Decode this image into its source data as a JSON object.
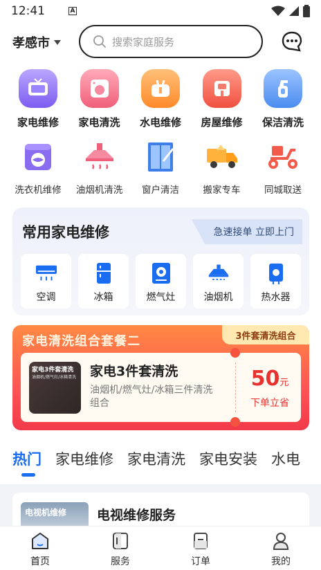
{
  "status_bar": {
    "time": "12:41",
    "a_icon": "A"
  },
  "header": {
    "city": "孝感市",
    "search_placeholder": "搜索家庭服务"
  },
  "main_services": [
    {
      "label": "家电维修",
      "icon": "tv-icon",
      "color": "#8a6cf0"
    },
    {
      "label": "家电清洗",
      "icon": "washer-icon",
      "color": "#f0607a"
    },
    {
      "label": "水电维修",
      "icon": "wrench-icon",
      "color": "#ff8a2a"
    },
    {
      "label": "房屋维修",
      "icon": "house-icon",
      "color": "#f25a4a"
    },
    {
      "label": "保洁清洗",
      "icon": "spray-icon",
      "color": "#4a8cf0"
    }
  ],
  "sub_services": [
    {
      "label": "洗衣机维修",
      "icon": "washing-machine-icon"
    },
    {
      "label": "油烟机清洗",
      "icon": "range-hood-icon"
    },
    {
      "label": "窗户清洁",
      "icon": "window-icon"
    },
    {
      "label": "搬家专车",
      "icon": "truck-icon"
    },
    {
      "label": "同城取送",
      "icon": "scooter-icon"
    }
  ],
  "common_repair": {
    "title": "常用家电维修",
    "tag": "急速接单 立即上门",
    "items": [
      {
        "label": "空调",
        "icon": "air-conditioner-icon"
      },
      {
        "label": "冰箱",
        "icon": "fridge-icon"
      },
      {
        "label": "燃气灶",
        "icon": "gas-stove-icon"
      },
      {
        "label": "油烟机",
        "icon": "range-hood-icon"
      },
      {
        "label": "热水器",
        "icon": "water-heater-icon"
      }
    ]
  },
  "promo": {
    "title": "家电清洗组合套餐二",
    "badge": "3件套清洗组合",
    "thumb_title": "家电3件套清洗",
    "thumb_sub": "油烟机/燃气灶/冰箱清洗",
    "name": "家电3件套清洗",
    "desc": "油烟机/燃气灶/冰箱三件清洗组合",
    "price": "50",
    "unit": "元",
    "cta": "下单立省"
  },
  "tabs": [
    "热门",
    "家电维修",
    "家电清洗",
    "家电安装",
    "水电"
  ],
  "list": {
    "thumb_text": "电视机维修",
    "title": "电视维修服务"
  },
  "bottom_nav": [
    {
      "label": "首页",
      "icon": "home-icon"
    },
    {
      "label": "服务",
      "icon": "service-icon"
    },
    {
      "label": "订单",
      "icon": "order-icon"
    },
    {
      "label": "我的",
      "icon": "profile-icon"
    }
  ],
  "colors": {
    "accent": "#1a6cf0",
    "promo_red": "#e8322f"
  }
}
